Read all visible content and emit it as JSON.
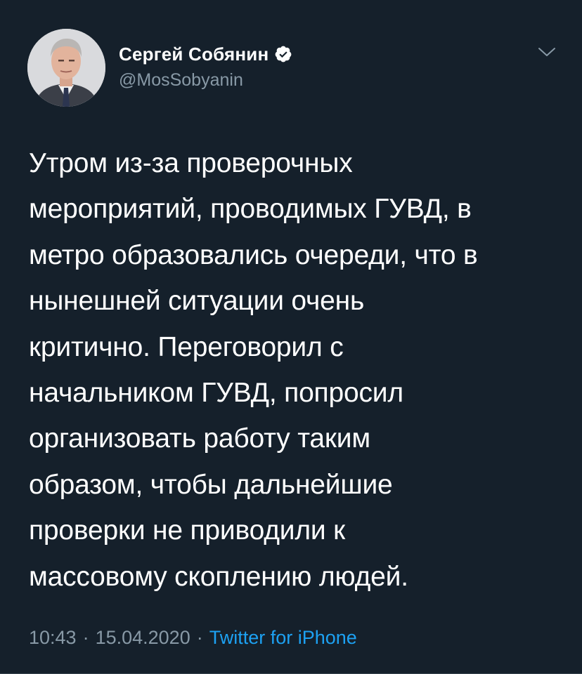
{
  "tweet": {
    "author": {
      "display_name": "Сергей Собянин",
      "handle": "@MosSobyanin",
      "verified": true,
      "verified_icon": "verified-badge-icon",
      "avatar_icon": "avatar-photo"
    },
    "menu_icon": "chevron-down-icon",
    "text": "Утром из-за проверочных\nмероприятий, проводимых ГУВД, в\nметро образовались очереди, что в\nнынешней ситуации очень\nкритично. Переговорил с\nначальником ГУВД, попросил\nорганизовать работу таким\nобразом, чтобы дальнейшие\nпроверки не приводили к\nмассовому скоплению людей.",
    "time": "10:43",
    "date": "15.04.2020",
    "separator": "·",
    "source": "Twitter for iPhone"
  },
  "colors": {
    "background": "#15202b",
    "text_primary": "#ffffff",
    "text_secondary": "#8899a6",
    "link": "#1da1f2",
    "divider": "#38444d"
  }
}
